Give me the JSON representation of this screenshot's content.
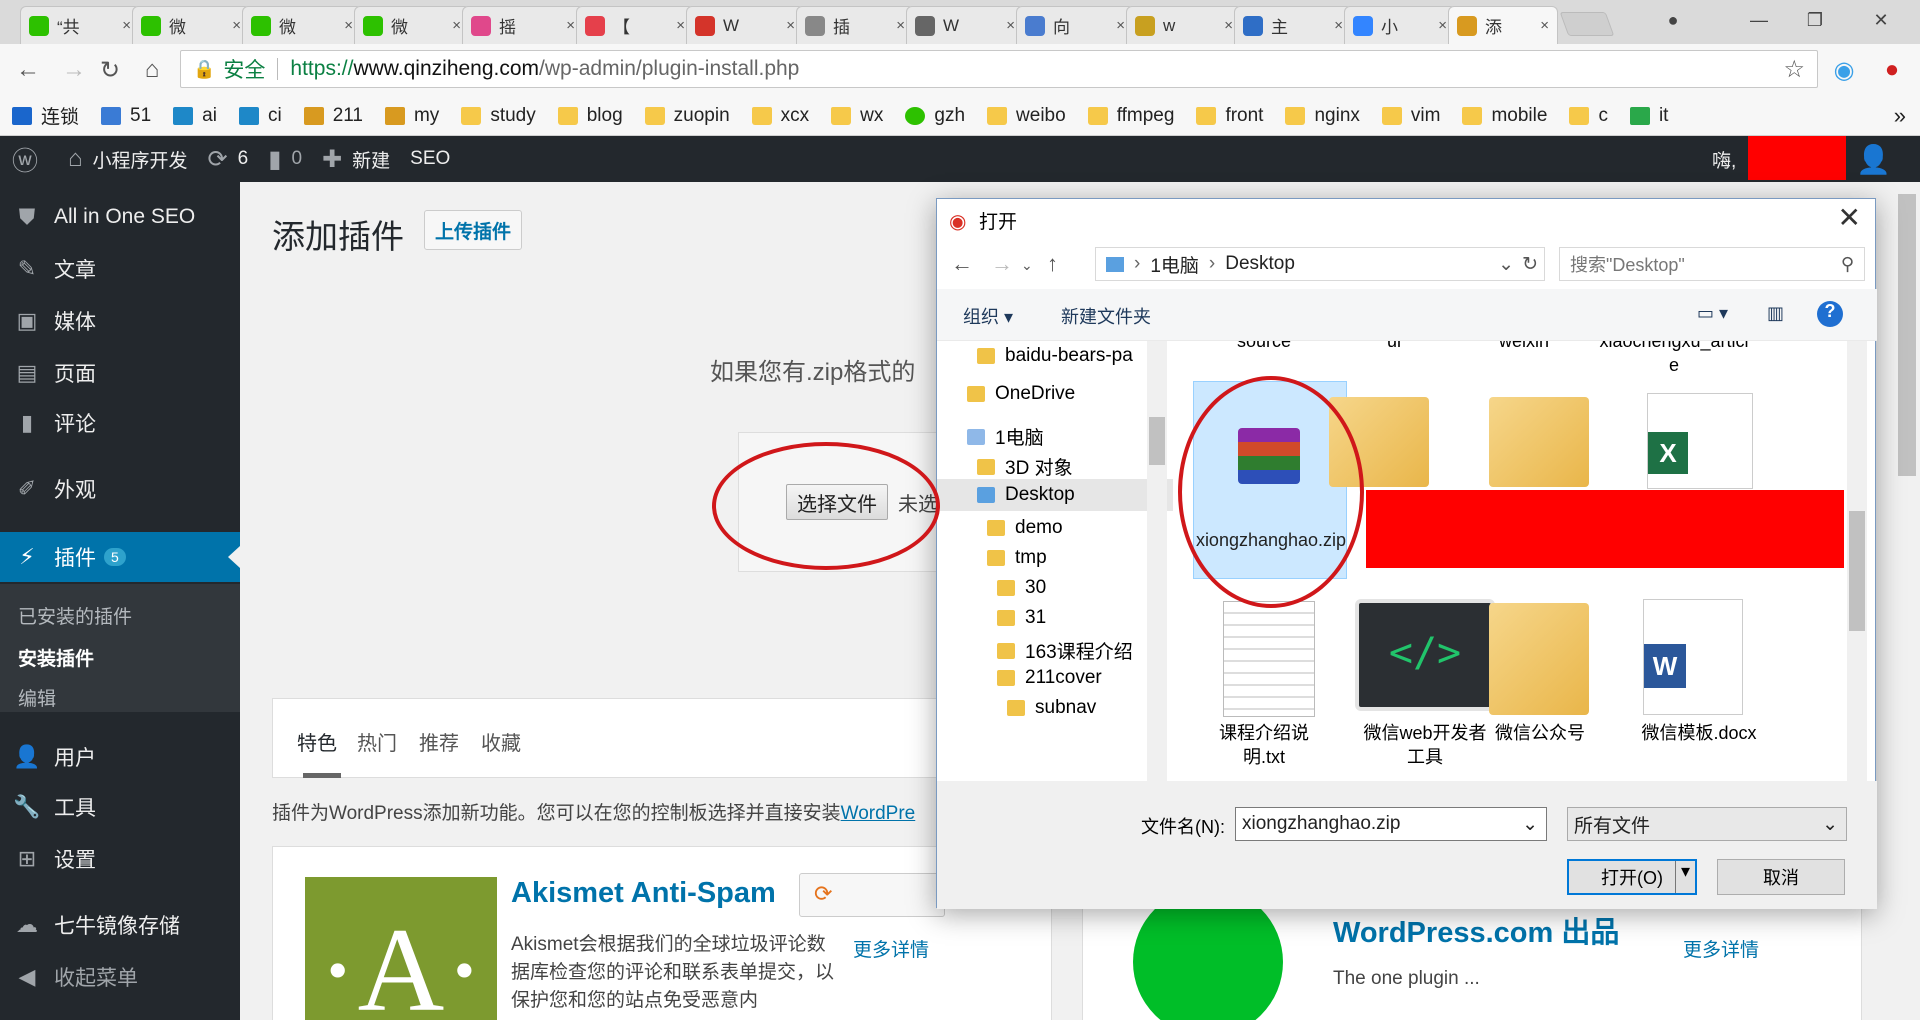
{
  "browser": {
    "tabs": [
      {
        "label": "“共",
        "color": "#2dc100"
      },
      {
        "label": "微",
        "color": "#2dc100"
      },
      {
        "label": "微",
        "color": "#2dc100"
      },
      {
        "label": "微",
        "color": "#2dc100"
      },
      {
        "label": "摇",
        "color": "#e0488b"
      },
      {
        "label": "【",
        "color": "#e5404b"
      },
      {
        "label": "W",
        "color": "#d4342a"
      },
      {
        "label": "插",
        "color": "#888888"
      },
      {
        "label": "W",
        "color": "#666666"
      },
      {
        "label": "向",
        "color": "#4a7ccf"
      },
      {
        "label": "w",
        "color": "#c8a020"
      },
      {
        "label": "主",
        "color": "#2f6ec6"
      },
      {
        "label": "小",
        "color": "#3385ff"
      },
      {
        "label": "添",
        "color": "#d89a20"
      }
    ],
    "close_glyph": "×",
    "url": {
      "secure_label": "安全",
      "scheme": "https://",
      "host": "www.qinziheng.com",
      "path": "/wp-admin/plugin-install.php"
    },
    "bookmarks": [
      "连锁",
      "51",
      "ai",
      "ci",
      "211",
      "my",
      "study",
      "blog",
      "zuopin",
      "xcx",
      "wx",
      "gzh",
      "weibo",
      "ffmpeg",
      "front",
      "nginx",
      "vim",
      "mobile",
      "c",
      "it"
    ],
    "more": "»"
  },
  "adminbar": {
    "site": "小程序开发",
    "updates": "6",
    "comments": "0",
    "new": "新建",
    "seo": "SEO",
    "greeting": "嗨,"
  },
  "sidebar": {
    "seo": "All in One SEO",
    "posts": "文章",
    "media": "媒体",
    "pages": "页面",
    "comments": "评论",
    "appearance": "外观",
    "plugins": "插件",
    "plugins_badge": "5",
    "sub_installed": "已安装的插件",
    "sub_add": "安装插件",
    "sub_editor": "编辑",
    "users": "用户",
    "tools": "工具",
    "settings": "设置",
    "qiniu": "七牛镜像存储",
    "collapse": "收起菜单"
  },
  "content": {
    "title": "添加插件",
    "upload_button": "上传插件",
    "upload_hint": "如果您有.zip格式的",
    "choose_file": "选择文件",
    "no_file": "未选",
    "filter_tabs": [
      "特色",
      "热门",
      "推荐",
      "收藏"
    ],
    "intro_text": "插件为WordPress添加新功能。您可以在您的控制板选择并直接安装",
    "intro_link": "WordPre",
    "cards": [
      {
        "title": "Akismet Anti-Spam",
        "desc": "Akismet会根据我们的全球垃圾评论数据库检查您的评论和联系表单提交，以保护您和您的站点免受恶意内",
        "more": "更多详情"
      },
      {
        "title": "WordPress.com 出品",
        "desc": "The one plugin ...",
        "more": "更多详情"
      }
    ]
  },
  "dialog": {
    "title": "打开",
    "path": [
      "1电脑",
      "Desktop"
    ],
    "search_placeholder": "搜索\"Desktop\"",
    "organize": "组织",
    "new_folder": "新建文件夹",
    "tree": [
      "baidu-bears-pa",
      "OneDrive",
      "1电脑",
      "3D 对象",
      "Desktop",
      "demo",
      "tmp",
      "30",
      "31",
      "163课程介绍",
      "211cover",
      "subnav"
    ],
    "top_row_partial": [
      "source",
      "ui",
      "weixin",
      "xiaochengxu_article"
    ],
    "files": [
      {
        "name": "xiongzhanghao.zip"
      },
      {
        "name": "课程介绍说明.txt"
      },
      {
        "name": "微信web开发者工具"
      },
      {
        "name": "微信公众号"
      },
      {
        "name": "微信模板.docx"
      }
    ],
    "filename_label": "文件名(N):",
    "filename_value": "xiongzhanghao.zip",
    "filetype": "所有文件",
    "open_button": "打开(O)",
    "cancel_button": "取消"
  },
  "colors": {
    "wp_dark": "#23282d",
    "wp_blue": "#0073aa",
    "annotation_red": "#d0171a",
    "redaction": "#ff0000"
  }
}
